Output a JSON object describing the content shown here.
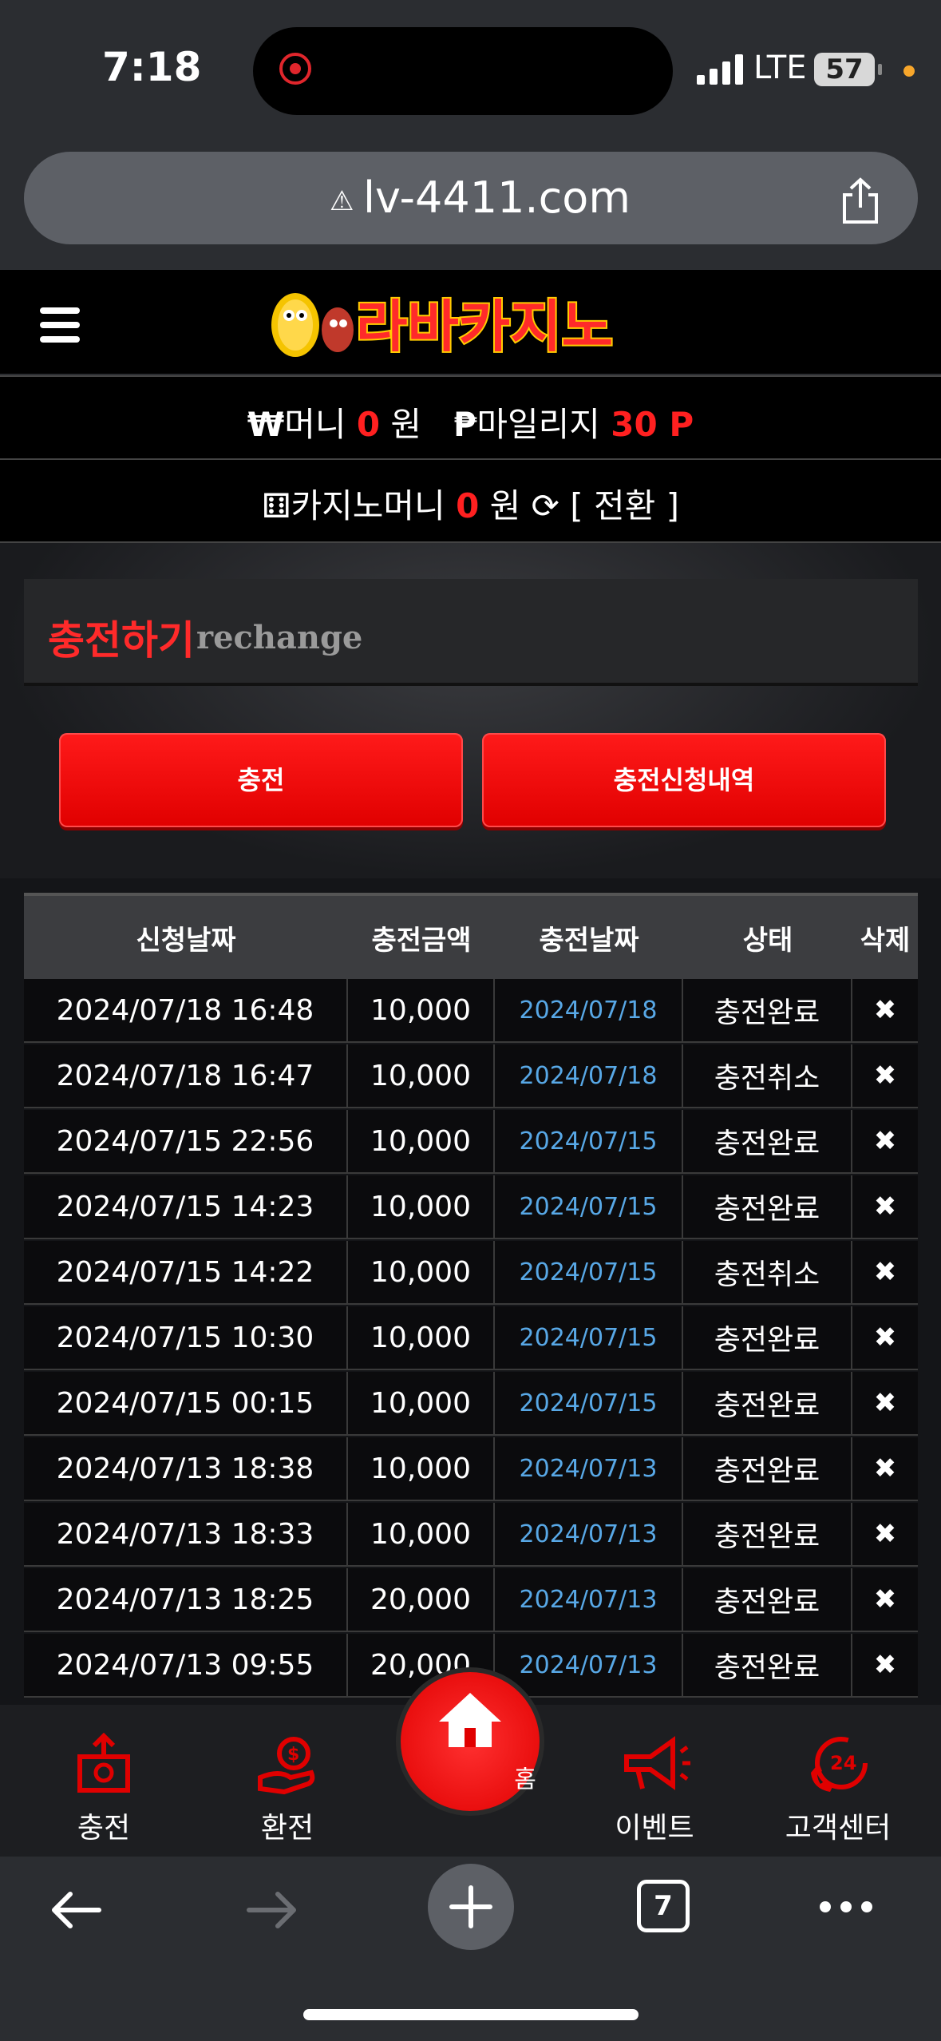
{
  "status": {
    "time": "7:18",
    "network": "LTE",
    "battery": "57"
  },
  "browser": {
    "url": "lv-4411.com",
    "tab_count": "7"
  },
  "site": {
    "logo_text": "라바카지노",
    "money_label": "머니",
    "money_value": "0",
    "money_unit": "원",
    "mileage_label": "마일리지",
    "mileage_value": "30 P",
    "casino_label": "카지노머니",
    "casino_value": "0",
    "casino_unit": "원",
    "convert_label": "[ 전환 ]"
  },
  "section": {
    "title": "충전하기",
    "subtitle": "rechange"
  },
  "buttons": {
    "charge": "충전",
    "history": "충전신청내역"
  },
  "table": {
    "headers": [
      "신청날짜",
      "충전금액",
      "충전날짜",
      "상태",
      "삭제"
    ],
    "rows": [
      [
        "2024/07/18 16:48",
        "10,000",
        "2024/07/18",
        "충전완료",
        "✖"
      ],
      [
        "2024/07/18 16:47",
        "10,000",
        "2024/07/18",
        "충전취소",
        "✖"
      ],
      [
        "2024/07/15 22:56",
        "10,000",
        "2024/07/15",
        "충전완료",
        "✖"
      ],
      [
        "2024/07/15 14:23",
        "10,000",
        "2024/07/15",
        "충전완료",
        "✖"
      ],
      [
        "2024/07/15 14:22",
        "10,000",
        "2024/07/15",
        "충전취소",
        "✖"
      ],
      [
        "2024/07/15 10:30",
        "10,000",
        "2024/07/15",
        "충전완료",
        "✖"
      ],
      [
        "2024/07/15 00:15",
        "10,000",
        "2024/07/15",
        "충전완료",
        "✖"
      ],
      [
        "2024/07/13 18:38",
        "10,000",
        "2024/07/13",
        "충전완료",
        "✖"
      ],
      [
        "2024/07/13 18:33",
        "10,000",
        "2024/07/13",
        "충전완료",
        "✖"
      ],
      [
        "2024/07/13 18:25",
        "20,000",
        "2024/07/13",
        "충전완료",
        "✖"
      ],
      [
        "2024/07/13 09:55",
        "20,000",
        "2024/07/13",
        "충전완료",
        "✖"
      ]
    ]
  },
  "bottom_nav": {
    "charge": "충전",
    "exchange": "환전",
    "home": "홈",
    "event": "이벤트",
    "support": "고객센터"
  },
  "colors": {
    "accent_red": "#ff1a1a",
    "link_blue": "#58a8e6"
  }
}
